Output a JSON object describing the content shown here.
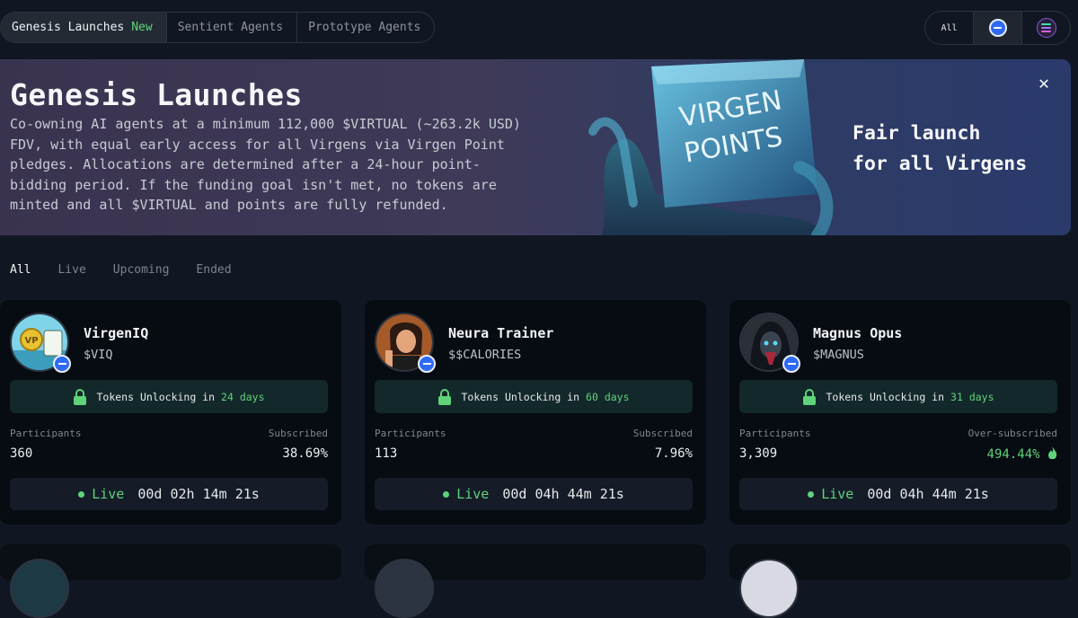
{
  "tabs": [
    {
      "label": "Genesis Launches",
      "badge": "New"
    },
    {
      "label": "Sentient Agents"
    },
    {
      "label": "Prototype Agents"
    }
  ],
  "chain_filter": {
    "all_label": "All",
    "icons": [
      "base-chain-icon",
      "solana-chain-icon"
    ]
  },
  "banner": {
    "title": "Genesis Launches",
    "description": "Co-owning AI agents at a minimum 112,000 $VIRTUAL (~263.2k USD) FDV, with equal early access for all Virgens via Virgen Point pledges. Allocations are determined after a 24-hour point-bidding period. If the funding goal isn't met, no tokens are minted and all $VIRTUAL and points are fully refunded.",
    "art_text": [
      "VIRGEN",
      "POINTS"
    ],
    "tagline_line1": "Fair launch",
    "tagline_line2": "for all Virgens",
    "close_icon": "close-icon"
  },
  "status_tabs": [
    {
      "label": "All",
      "active": true
    },
    {
      "label": "Live"
    },
    {
      "label": "Upcoming"
    },
    {
      "label": "Ended"
    }
  ],
  "cards": [
    {
      "name": "VirgenIQ",
      "ticker": "$VIQ",
      "unlock_prefix": "Tokens Unlocking in",
      "unlock_days": "24 days",
      "participants_label": "Participants",
      "participants": "360",
      "subscribed_label": "Subscribed",
      "subscribed": "38.69%",
      "status": "Live",
      "countdown": "00d 02h 14m 21s"
    },
    {
      "name": "Neura Trainer",
      "ticker": "$$CALORIES",
      "unlock_prefix": "Tokens Unlocking in",
      "unlock_days": "60 days",
      "participants_label": "Participants",
      "participants": "113",
      "subscribed_label": "Subscribed",
      "subscribed": "7.96%",
      "status": "Live",
      "countdown": "00d 04h 44m 21s"
    },
    {
      "name": "Magnus Opus",
      "ticker": "$MAGNUS",
      "unlock_prefix": "Tokens Unlocking in",
      "unlock_days": "31 days",
      "participants_label": "Participants",
      "participants": "3,309",
      "subscribed_label": "Over-subscribed",
      "subscribed": "494.44%",
      "status": "Live",
      "countdown": "00d 04h 44m 21s"
    }
  ],
  "colors": {
    "accent_green": "#5fd37a",
    "base_blue": "#2f6af5",
    "background": "#111722",
    "card": "#070b12"
  }
}
